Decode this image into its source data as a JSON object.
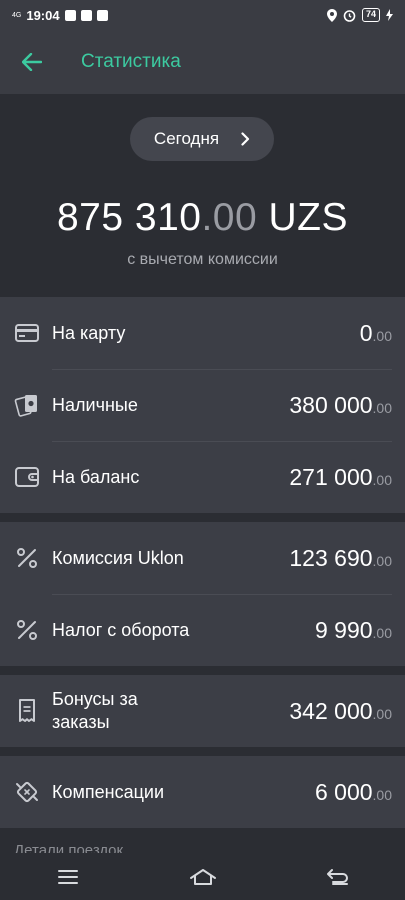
{
  "status_bar": {
    "network": "4G",
    "time": "19:04",
    "battery": "74"
  },
  "header": {
    "title": "Статистика"
  },
  "summary": {
    "period_label": "Сегодня",
    "total_main": "875 310",
    "total_decimal": ".00",
    "total_currency": " UZS",
    "subtitle": "с вычетом комиссии"
  },
  "payments": [
    {
      "label": "На карту",
      "amount": "0",
      "cents": ".00",
      "icon": "card-icon"
    },
    {
      "label": "Наличные",
      "amount": "380 000",
      "cents": ".00",
      "icon": "cash-icon"
    },
    {
      "label": "На баланс",
      "amount": "271 000",
      "cents": ".00",
      "icon": "wallet-icon"
    }
  ],
  "deductions": [
    {
      "label": "Комиссия Uklon",
      "amount": "123 690",
      "cents": ".00",
      "icon": "percent-icon"
    },
    {
      "label": "Налог с оборота",
      "amount": "9 990",
      "cents": ".00",
      "icon": "percent-icon"
    }
  ],
  "bonuses": {
    "label": "Бонусы за заказы",
    "amount": "342 000",
    "cents": ".00",
    "icon": "receipt-icon"
  },
  "compensation": {
    "label": "Компенсации",
    "amount": "6 000",
    "cents": ".00",
    "icon": "compensation-icon"
  },
  "footer_text": "Детали поездок"
}
